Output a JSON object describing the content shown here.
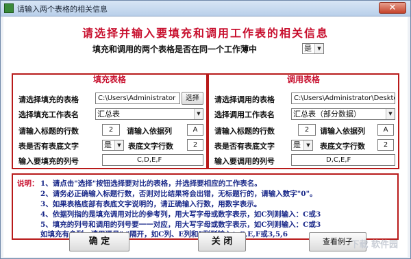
{
  "window": {
    "title": "请输入两个表格的相关信息",
    "close_glyph": "✕"
  },
  "headline": "请选择并输入要填充和调用工作表的相关信息",
  "same_workbook": {
    "label": "填充和调用的两个表格是否在同一个工作薄中",
    "value": "是"
  },
  "fill_panel": {
    "title": "填充表格",
    "table_label": "请选择填充的表格",
    "table_path": "C:\\Users\\Administrator",
    "browse_button": "选择",
    "sheet_label": "选择填充工作表名",
    "sheet_value": "汇总表",
    "header_rows_label": "请输入标题的行数",
    "header_rows_value": "2",
    "basis_col_label": "请输入依据列",
    "basis_col_value": "A",
    "has_footer_label": "表是否有表底文字",
    "has_footer_value": "是",
    "footer_rows_label": "表底文字行数",
    "footer_rows_value": "2",
    "columns_label": "输入要填充的列号",
    "columns_value": "C,D,E,F"
  },
  "call_panel": {
    "title": "调用表格",
    "table_label": "请选择调用的表格",
    "table_path": "C:\\Users\\Administrator\\Deskto",
    "sheet_label": "选择调用工作表名",
    "sheet_value": "汇总表（部分数据）",
    "header_rows_label": "请输入标题的行数",
    "header_rows_value": "2",
    "basis_col_label": "请输入依据列",
    "basis_col_value": "A",
    "has_footer_label": "表是否有表底文字",
    "has_footer_value": "是",
    "footer_rows_label": "表底文字行数",
    "footer_rows_value": "2",
    "columns_label": "输入要调用的列号",
    "columns_value": "D,C,E,F"
  },
  "notes": {
    "label": "说明：",
    "lines": [
      "1、请点击\"选择\"按钮选择要对比的表格，并选择要相应的工作表名。",
      "2、请务必正确输入标题行数，否则对比结果将会出错，无标题行的，请输入数字\"0\"。",
      "3、如果表格底部有表底文字说明的，请正确输入行数，用数字表示。",
      "4、依据列指的是填充调用对比的参考列，用大写字母或数字表示，如C列则输入：C或3",
      "5、填充的列号和调用的列号要一一对应，用大写字母或数字表示，如C列则输入：C或3",
      "   如填充有多列，请用逗号\",\"隔开，如C列、E列和F列则输入：C,E,F或3,5,6"
    ]
  },
  "buttons": {
    "ok": "确  定",
    "close": "关  闭",
    "example": "查看例子"
  },
  "watermark": "下载 软件园"
}
